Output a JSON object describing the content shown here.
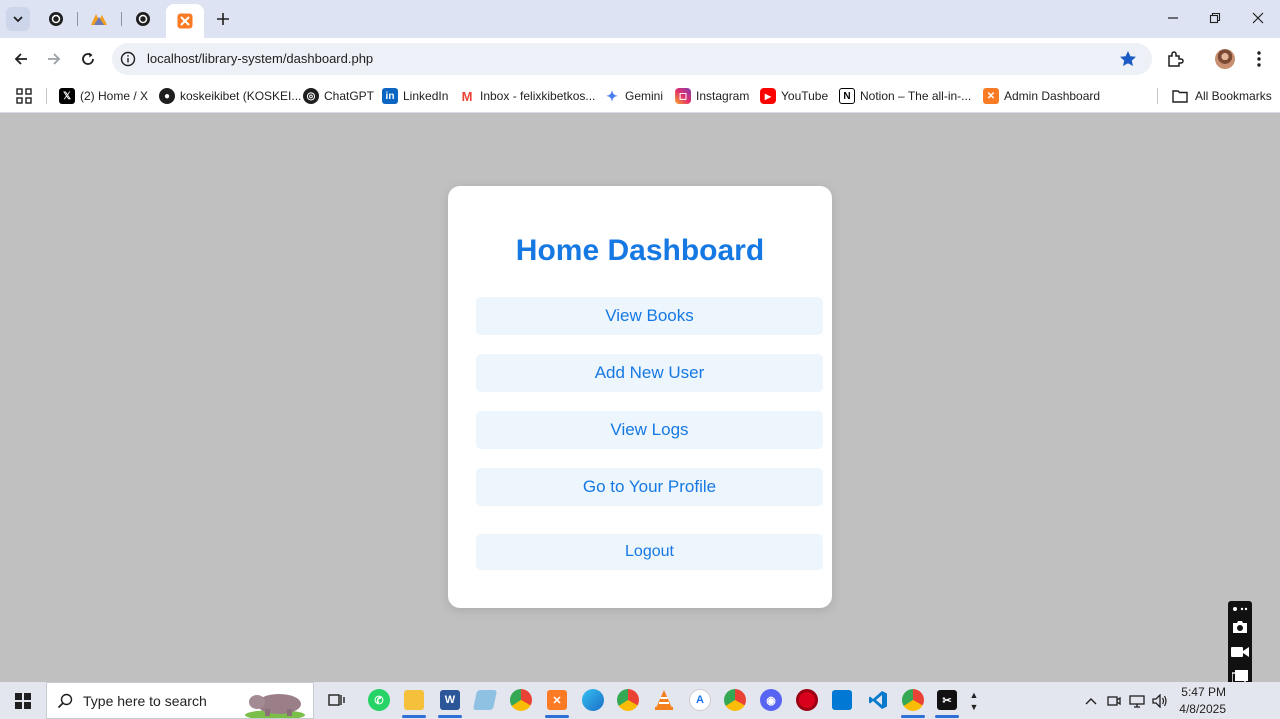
{
  "browser": {
    "active_tab_title": "Admin Dashboard",
    "url": "localhost/library-system/dashboard.php",
    "bookmarks": [
      {
        "label": "(2) Home / X",
        "icon": "x-icon"
      },
      {
        "label": "koskeikibet (KOSKEI...",
        "icon": "github-icon"
      },
      {
        "label": "ChatGPT",
        "icon": "chatgpt-icon"
      },
      {
        "label": "LinkedIn",
        "icon": "linkedin-icon"
      },
      {
        "label": "Inbox - felixkibetkos...",
        "icon": "gmail-icon"
      },
      {
        "label": "Gemini",
        "icon": "gemini-icon"
      },
      {
        "label": "Instagram",
        "icon": "instagram-icon"
      },
      {
        "label": "YouTube",
        "icon": "youtube-icon"
      },
      {
        "label": "Notion – The all-in-...",
        "icon": "notion-icon"
      },
      {
        "label": "Admin Dashboard",
        "icon": "xampp-icon"
      }
    ],
    "all_bookmarks_label": "All Bookmarks"
  },
  "page": {
    "title": "Home Dashboard",
    "buttons": {
      "view_books": "View Books",
      "add_user": "Add New User",
      "view_logs": "View Logs",
      "profile": "Go to Your Profile",
      "logout": "Logout"
    },
    "accent_color": "#1679e3",
    "button_bg": "#edf5fd",
    "background": "#c0c0c0"
  },
  "taskbar": {
    "search_placeholder": "Type here to search",
    "time": "5:47 PM",
    "date": "4/8/2025"
  }
}
